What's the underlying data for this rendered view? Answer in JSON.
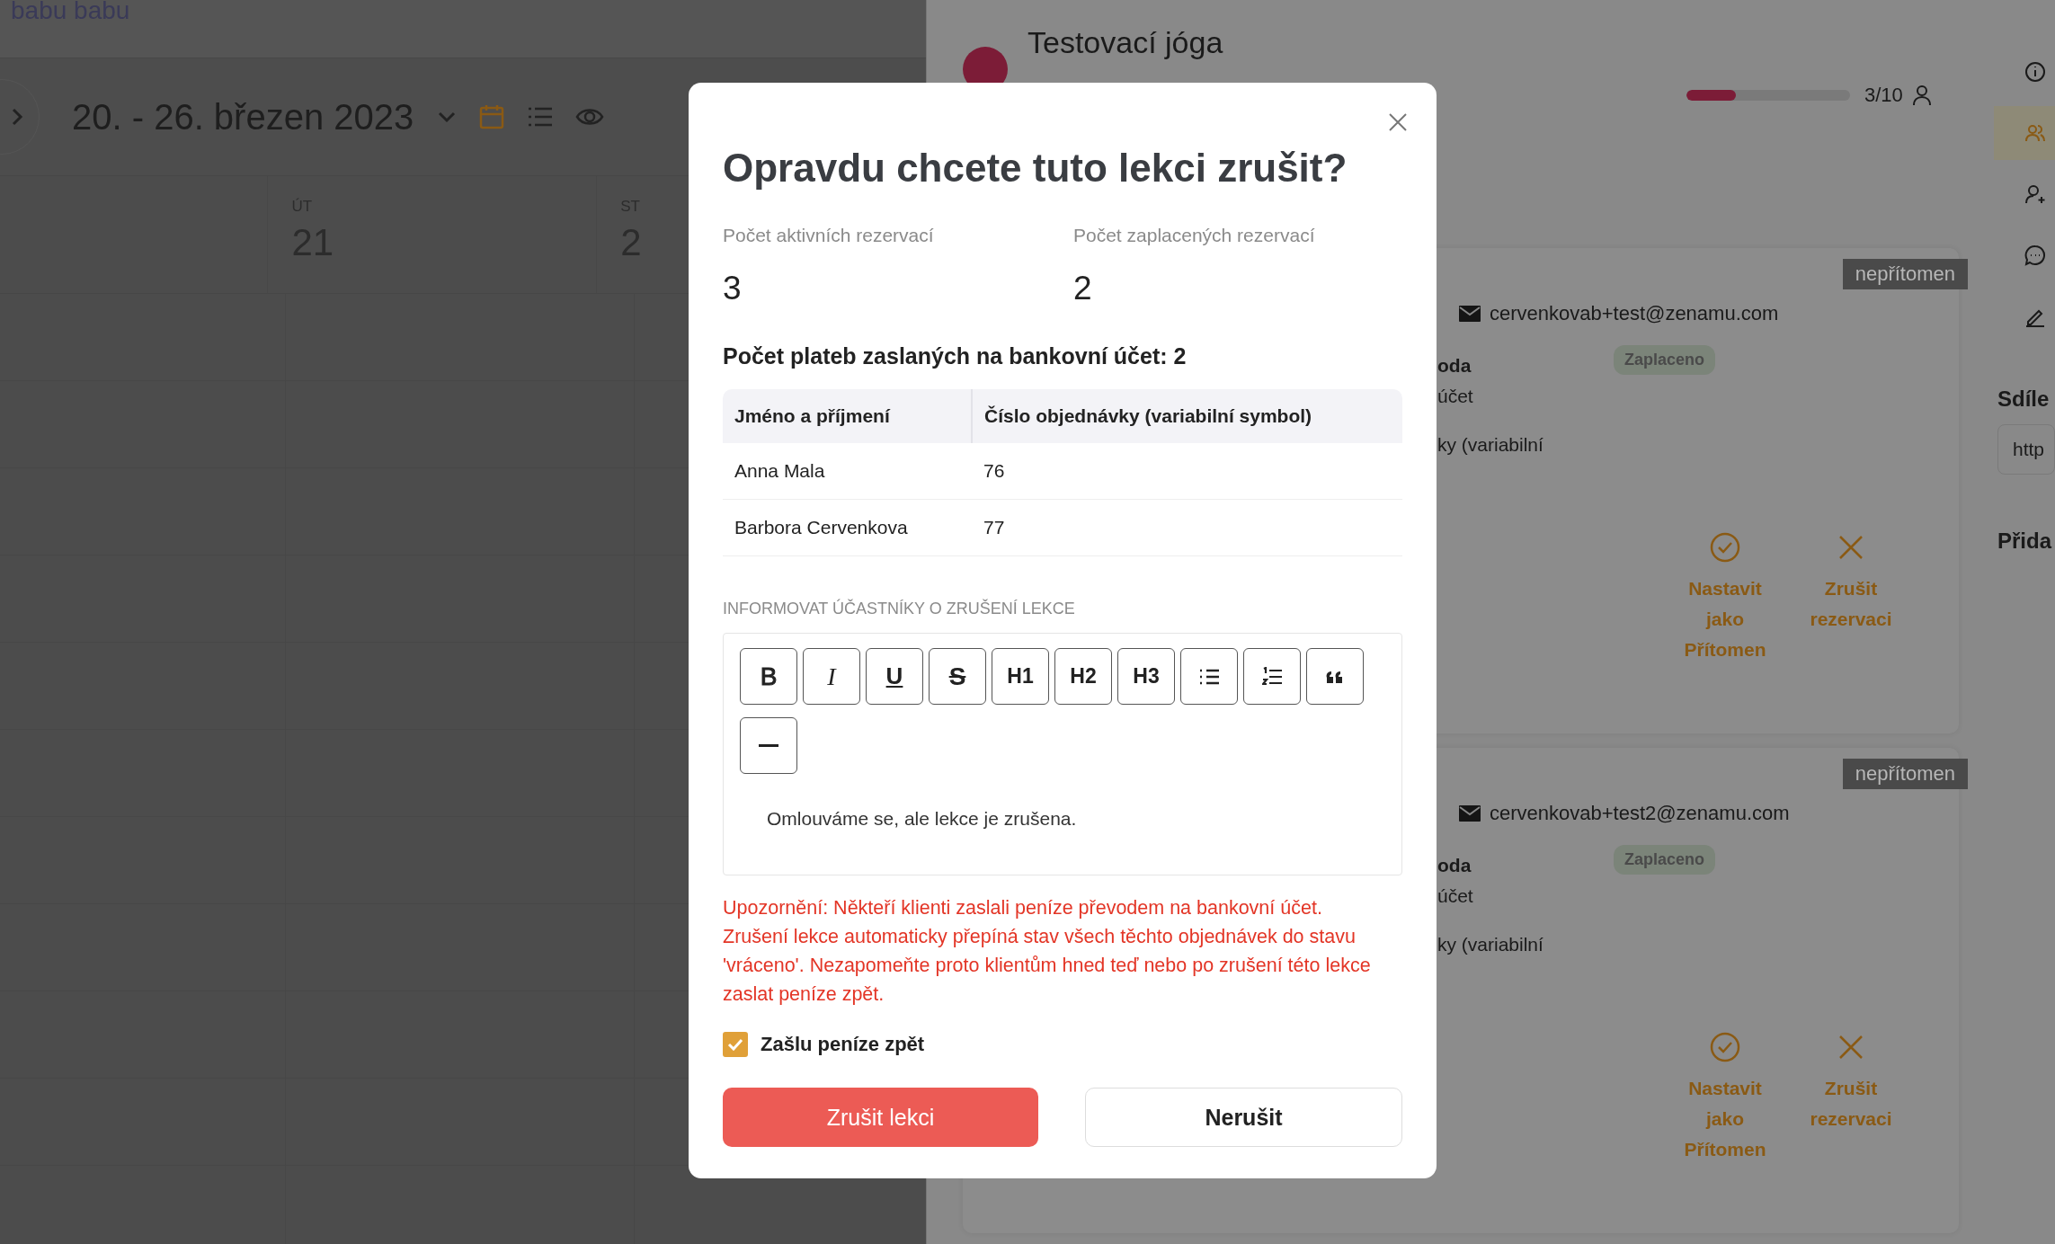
{
  "header": {
    "user": "babu babu"
  },
  "calendar": {
    "date_range": "20. - 26. březen 2023",
    "view_toggles": [
      {
        "kind": "calendar",
        "selected": true
      },
      {
        "kind": "list",
        "selected": false
      },
      {
        "kind": "eye",
        "selected": false
      }
    ],
    "days": [
      {
        "weekday": "ÚT",
        "day": "21"
      },
      {
        "weekday": "ST",
        "day": "2"
      }
    ]
  },
  "lesson": {
    "title": "Testovací jóga",
    "capacity": {
      "level": 0.3,
      "reading": "3/10"
    }
  },
  "reservations": [
    {
      "status": "nepřítomen",
      "email": "cervenkovab+test@zenamu.com",
      "fragments": [
        "oda",
        "účet",
        "ky (variabilní"
      ],
      "payment": "Zaplaceno",
      "actions": [
        {
          "kind": "present",
          "label": "Nastavit jako Přítomen"
        },
        {
          "kind": "cancel",
          "label": "Zrušit rezervaci"
        }
      ]
    },
    {
      "status": "nepřítomen",
      "email": "cervenkovab+test2@zenamu.com",
      "fragments": [
        "oda",
        "účet",
        "ky (variabilní"
      ],
      "payment": "Zaplaceno",
      "actions": [
        {
          "kind": "present",
          "label": "Nastavit jako Přítomen"
        },
        {
          "kind": "cancel",
          "label": "Zrušit rezervaci"
        }
      ]
    }
  ],
  "side_rail": {
    "icons": [
      {
        "kind": "info",
        "selected": false
      },
      {
        "kind": "people",
        "selected": true
      },
      {
        "kind": "person-add",
        "selected": false
      },
      {
        "kind": "chat",
        "selected": false
      },
      {
        "kind": "edit",
        "selected": false
      }
    ],
    "share_label": "Sdíle",
    "share_field": "http",
    "add_label": "Přida"
  },
  "dialog": {
    "title": "Opravdu chcete tuto lekci zrušit?",
    "stats": [
      {
        "label": "Počet aktivních rezervací",
        "value": "3"
      },
      {
        "label": "Počet zaplacených rezervací",
        "value": "2"
      }
    ],
    "payments_heading": "Počet plateb zaslaných na bankovní účet: 2",
    "table": {
      "columns": [
        "Jméno a příjmení",
        "Číslo objednávky (variabilní symbol)"
      ],
      "rows": [
        [
          "Anna Mala",
          "76"
        ],
        [
          "Barbora Cervenkova",
          "77"
        ]
      ]
    },
    "notify_label": "INFORMOVAT ÚČASTNÍKY O ZRUŠENÍ LEKCE",
    "toolbar": [
      {
        "kind": "bold",
        "label": "B"
      },
      {
        "kind": "italic",
        "label": "I"
      },
      {
        "kind": "underline",
        "label": "U"
      },
      {
        "kind": "strike",
        "label": "S"
      },
      {
        "kind": "heading",
        "label": "H1"
      },
      {
        "kind": "heading",
        "label": "H2"
      },
      {
        "kind": "heading",
        "label": "H3"
      },
      {
        "kind": "bullet-list"
      },
      {
        "kind": "ordered-list"
      },
      {
        "kind": "quote"
      },
      {
        "kind": "rule"
      }
    ],
    "message": "Omlouváme se, ale lekce je zrušena.",
    "warning": "Upozornění: Někteří klienti zaslali peníze převodem na bankovní účet. Zrušení lekce automaticky přepíná stav všech těchto objednávek do stavu 'vráceno'. Nezapomeňte proto klientům hned teď nebo po zrušení této lekce zaslat peníze zpět.",
    "checkbox": {
      "label": "Zašlu peníze zpět",
      "checked": true
    },
    "buttons": [
      {
        "kind": "danger",
        "label": "Zrušit lekci"
      },
      {
        "kind": "secondary",
        "label": "Nerušit"
      }
    ]
  }
}
